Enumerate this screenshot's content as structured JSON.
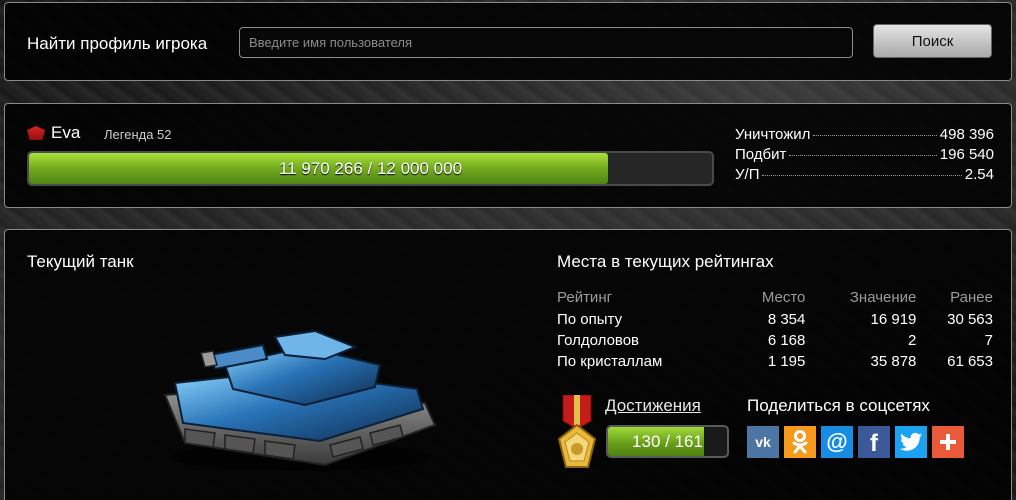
{
  "search": {
    "label": "Найти профиль игрока",
    "placeholder": "Введите имя пользователя",
    "button_label": "Поиск"
  },
  "profile": {
    "name": "Eva",
    "rank": "Легенда 52",
    "xp_text": "11 970 266 / 12 000 000",
    "xp_progress_percent": 84.8,
    "stats": [
      {
        "label": "Уничтожил",
        "value": "498 396"
      },
      {
        "label": "Подбит",
        "value": "196 540"
      },
      {
        "label": "У/П",
        "value": "2.54"
      }
    ]
  },
  "tank_section": {
    "title": "Текущий танк"
  },
  "ratings": {
    "title": "Места в текущих рейтингах",
    "headers": [
      "Рейтинг",
      "Место",
      "Значение",
      "Ранее"
    ],
    "rows": [
      [
        "По опыту",
        "8 354",
        "16 919",
        "30 563"
      ],
      [
        "Голдоловов",
        "6 168",
        "2",
        "7"
      ],
      [
        "По кристаллам",
        "1 195",
        "35 878",
        "61 653"
      ]
    ]
  },
  "achievements": {
    "label": "Достижения",
    "progress_text": "130 / 161",
    "progress_percent": 80.7
  },
  "share": {
    "title": "Поделиться в соцсетях",
    "networks": [
      {
        "icon": "vk-icon",
        "glyph": "vk",
        "color": "#4c75a3"
      },
      {
        "icon": "odnoklassniki-icon",
        "glyph": "ok",
        "color": "#f59a1c"
      },
      {
        "icon": "mail-ru-icon",
        "glyph": "@",
        "color": "#168de2"
      },
      {
        "icon": "facebook-icon",
        "glyph": "f",
        "color": "#3b5998"
      },
      {
        "icon": "twitter-icon",
        "glyph": "tw",
        "color": "#1da1f2"
      },
      {
        "icon": "plus-share-icon",
        "glyph": "+",
        "color": "#e85a3a"
      }
    ]
  }
}
